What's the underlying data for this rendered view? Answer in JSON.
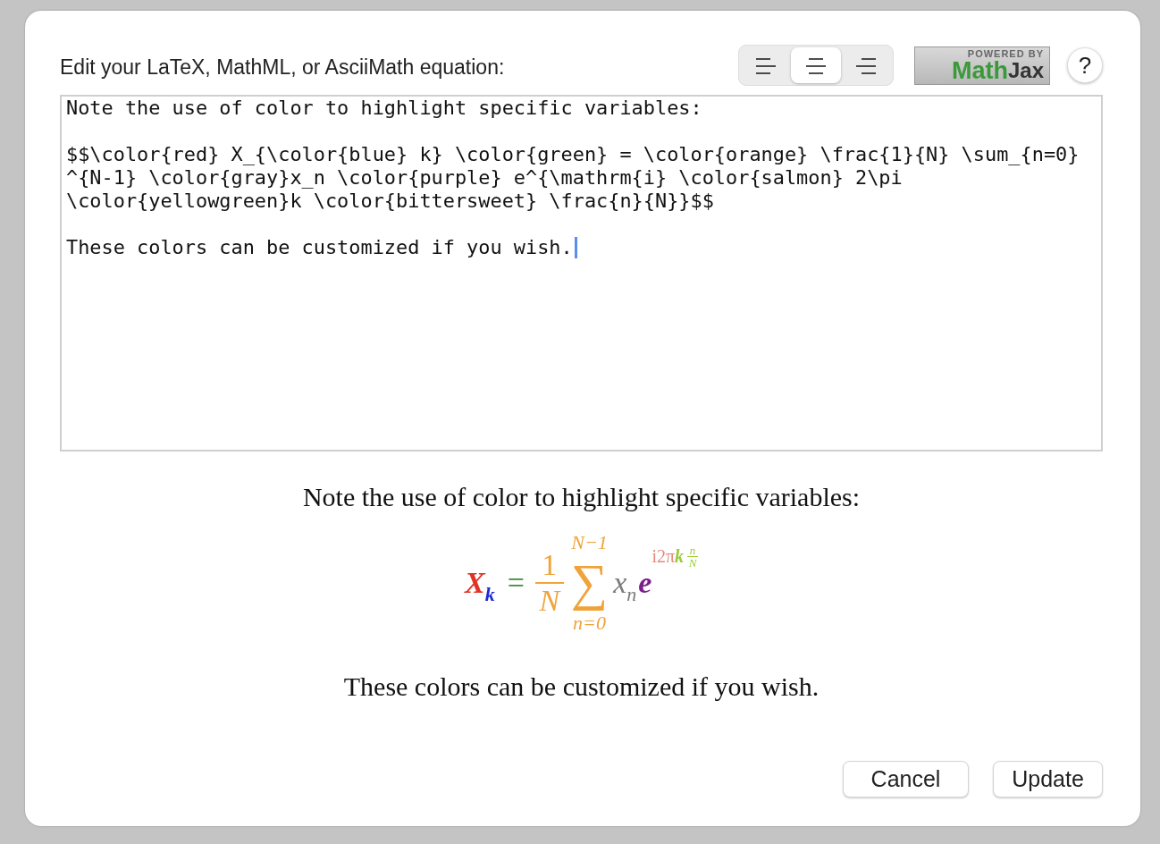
{
  "dialog": {
    "prompt": "Edit your LaTeX, MathML, or AsciiMath equation:"
  },
  "alignment_buttons": [
    {
      "kind": "left",
      "selected": false
    },
    {
      "kind": "center",
      "selected": true
    },
    {
      "kind": "right",
      "selected": false
    }
  ],
  "logo": {
    "top": "POWERED BY",
    "math": "Math",
    "jax": "Jax"
  },
  "help_button": "?",
  "editor": {
    "paragraphs": [
      [
        "Note the use of color to highlight specific variables:"
      ],
      [
        "$$\\color{red} X_{\\color{blue} k} \\color{green} = \\color{orange} \\frac{1}{N} \\sum_{n=0}",
        "^{N-1} \\color{gray}x_n \\color{purple} e^{\\mathrm{i} \\color{salmon} 2\\pi",
        "\\color{yellowgreen}k \\color{bittersweet} \\frac{n}{N}}$$"
      ],
      [
        "These colors can be customized if you wish."
      ]
    ]
  },
  "preview": {
    "intro": "Note the use of color to highlight specific variables:",
    "formula": {
      "x": {
        "text": "X",
        "color": "#e03325"
      },
      "x_sub": {
        "text": "k",
        "color": "#1f2bd6"
      },
      "equals": {
        "text": "=",
        "color": "#3c8c3c"
      },
      "frac_num": {
        "text": "1",
        "color": "#f0a33a"
      },
      "frac_den": {
        "text": "N",
        "color": "#f0a33a"
      },
      "sum_top": {
        "text": "N−1",
        "color": "#f0a33a"
      },
      "sum": {
        "text": "∑",
        "color": "#f0a33a"
      },
      "sum_bottom": {
        "text": "n=0",
        "color": "#f0a33a"
      },
      "xn": {
        "text": "x",
        "color": "#7a7a7a"
      },
      "xn_sub": {
        "text": "n",
        "color": "#7a7a7a"
      },
      "e": {
        "text": "e",
        "color": "#7b1e8c"
      },
      "exp": {
        "text": "i2π",
        "color": "#e4877a"
      },
      "exp_k": {
        "text": "k",
        "color": "#9acd32"
      },
      "exp_num": {
        "text": "n",
        "color": "#9acd32"
      },
      "exp_den": {
        "text": "N",
        "color": "#9acd32"
      }
    },
    "outro": "These colors can be customized if you wish."
  },
  "buttons": [
    "Cancel",
    "Update"
  ]
}
